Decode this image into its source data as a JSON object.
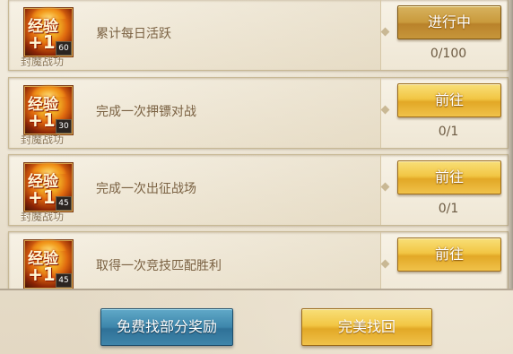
{
  "tasks": [
    {
      "icon": {
        "line1": "经验",
        "line2": "+1",
        "level": "60"
      },
      "source": "封魔战功",
      "title": "累计每日活跃",
      "button": "进行中",
      "progress": "0/100"
    },
    {
      "icon": {
        "line1": "经验",
        "line2": "+1",
        "level": "30"
      },
      "source": "封魔战功",
      "title": "完成一次押镖对战",
      "button": "前往",
      "progress": "0/1"
    },
    {
      "icon": {
        "line1": "经验",
        "line2": "+1",
        "level": "45"
      },
      "source": "封魔战功",
      "title": "完成一次出征战场",
      "button": "前往",
      "progress": "0/1"
    },
    {
      "icon": {
        "line1": "经验",
        "line2": "+1",
        "level": "45"
      },
      "source": "",
      "title": "取得一次竞技匹配胜利",
      "button": "前往",
      "progress": ""
    }
  ],
  "footer": {
    "free_label": "免费找部分奖励",
    "perfect_label": "完美找回"
  },
  "colors": {
    "gold_button": "#f2c644",
    "blue_button": "#3d86ab",
    "panel": "#f7f2e6",
    "text": "#7a6142"
  }
}
